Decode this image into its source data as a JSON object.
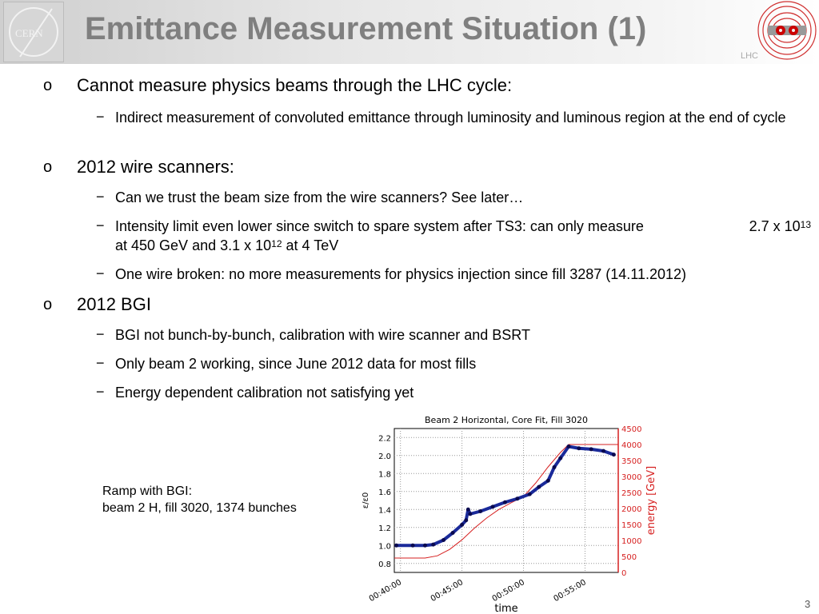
{
  "header": {
    "title": "Emittance Measurement Situation (1)",
    "cern_logo": "CERN",
    "lhc_logo": "LHC"
  },
  "bullets": [
    {
      "marker": "o",
      "text": "Cannot measure physics beams through  the LHC cycle:",
      "subs": [
        {
          "marker": "−",
          "text": "Indirect measurement of convoluted emittance through luminosity and luminous region   at the end of cycle"
        }
      ]
    },
    {
      "marker": "o",
      "text": "2012 wire scanners:",
      "subs": [
        {
          "marker": "−",
          "text": "Can we trust the beam size from the wire scanners? See later…"
        },
        {
          "marker": "−",
          "text_a": "Intensity limit even lower since switch to spare system after TS3: can only measure",
          "text_b": "2.7 x 10",
          "sup_b": "13",
          "text_c": "at 450 GeV and 3.1 x 10",
          "sup_c": "12",
          "text_d": " at 4 TeV"
        },
        {
          "marker": "−",
          "text": "One wire broken:  no more measurements for physics injection since fill 3287 (14.11.2012)"
        }
      ]
    },
    {
      "marker": "o",
      "text": "2012 BGI",
      "subs": [
        {
          "marker": "−",
          "text": "BGI not bunch-by-bunch, calibration with wire scanner and BSRT"
        },
        {
          "marker": "−",
          "text": "Only beam 2 working, since June 2012 data for most fills"
        },
        {
          "marker": "−",
          "text": "Energy dependent calibration not satisfying yet"
        }
      ]
    }
  ],
  "caption": {
    "line1": "Ramp with BGI:",
    "line2": "beam 2 H, fill 3020, 1374 bunches"
  },
  "page_number": "3",
  "chart_data": {
    "type": "line",
    "title": "Beam 2 Horizontal, Core Fit, Fill 3020",
    "xlabel": "time",
    "ylabel": "ε/ε0",
    "y2label": "energy [GeV]",
    "xlim": [
      "00:39:30",
      "00:57:42"
    ],
    "ylim": [
      0.7,
      2.3
    ],
    "y2lim": [
      0,
      4500
    ],
    "xticks": [
      "00:40:00",
      "00:45:00",
      "00:50:00",
      "00:55:00"
    ],
    "yticks": [
      "0.8",
      "1.0",
      "1.2",
      "1.4",
      "1.6",
      "1.8",
      "2.0",
      "2.2"
    ],
    "y2ticks": [
      "0",
      "500",
      "1000",
      "1500",
      "2000",
      "2500",
      "3000",
      "3500",
      "4000",
      "4500"
    ],
    "grid": true,
    "colors": {
      "emittance": "#1a2a9a",
      "energy": "#d62020"
    },
    "series": [
      {
        "axis": "left",
        "style": "markers",
        "x": [
          "00:39:40",
          "00:41:00",
          "00:42:00",
          "00:42:40",
          "00:43:30",
          "00:44:15",
          "00:45:00",
          "00:45:20",
          "00:45:30",
          "00:45:40",
          "00:46:30",
          "00:47:30",
          "00:48:30",
          "00:49:30",
          "00:50:30",
          "00:51:15",
          "00:52:00",
          "00:52:30",
          "00:53:00",
          "00:53:40",
          "00:54:30",
          "00:55:30",
          "00:56:30",
          "00:57:20"
        ],
        "y": [
          1.0,
          1.0,
          1.0,
          1.01,
          1.06,
          1.14,
          1.23,
          1.28,
          1.4,
          1.35,
          1.38,
          1.43,
          1.48,
          1.52,
          1.57,
          1.65,
          1.72,
          1.87,
          1.97,
          2.1,
          2.08,
          2.07,
          2.05,
          2.01
        ]
      },
      {
        "axis": "right",
        "style": "line",
        "x": [
          "00:39:30",
          "00:42:00",
          "00:43:00",
          "00:44:00",
          "00:45:00",
          "00:46:00",
          "00:47:00",
          "00:48:00",
          "00:49:00",
          "00:50:00",
          "00:51:00",
          "00:52:00",
          "00:53:00",
          "00:53:40",
          "00:57:42"
        ],
        "y": [
          450,
          450,
          520,
          720,
          1020,
          1380,
          1700,
          1970,
          2180,
          2370,
          2800,
          3300,
          3750,
          4000,
          4000
        ]
      }
    ]
  }
}
